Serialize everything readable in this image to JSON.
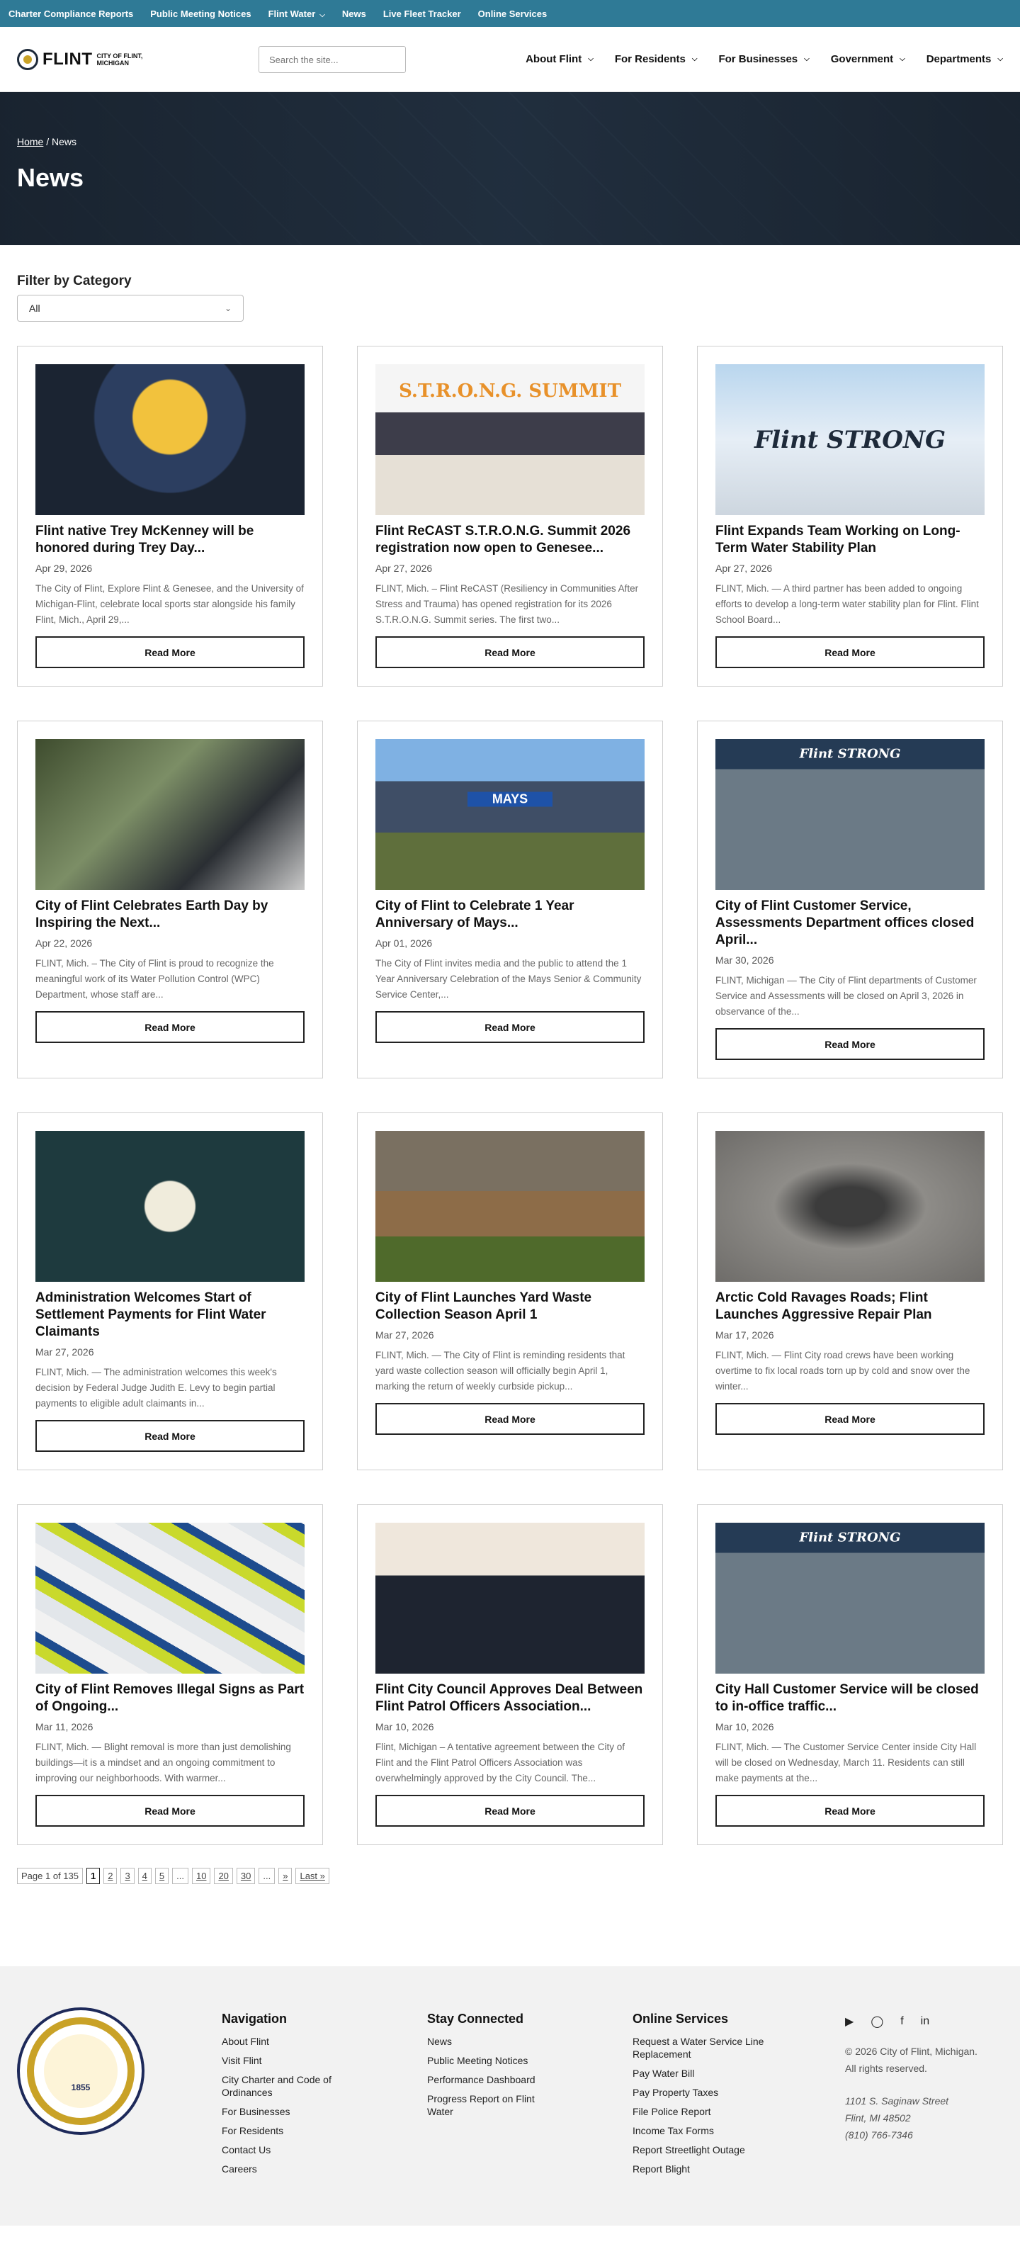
{
  "utility": [
    "Charter Compliance Reports",
    "Public Meeting Notices",
    "Flint Water",
    "News",
    "Live Fleet Tracker",
    "Online Services"
  ],
  "logo": {
    "word": "FLINT",
    "sub1": "CITY OF FLINT,",
    "sub2": "MICHIGAN"
  },
  "search": {
    "placeholder": "Search the site..."
  },
  "nav": [
    "About Flint",
    "For Residents",
    "For Businesses",
    "Government",
    "Departments"
  ],
  "hero": {
    "crumb_home": "Home",
    "crumb_sep": " / ",
    "crumb_current": "News",
    "title": "News"
  },
  "filter": {
    "heading": "Filter by Category",
    "selected": "All"
  },
  "read_more": "Read More",
  "cards": [
    {
      "title": "Flint native Trey McKenney will be honored during Trey Day...",
      "date": "Apr 29, 2026",
      "excerpt": "The City of Flint, Explore Flint & Genesee, and the University of Michigan-Flint, celebrate local sports star alongside his family Flint, Mich., April 29,..."
    },
    {
      "title": "Flint ReCAST S.T.R.O.N.G. Summit 2026 registration now open to Genesee...",
      "date": "Apr 27, 2026",
      "excerpt": "FLINT, Mich. – Flint ReCAST (Resiliency in Communities After Stress and Trauma) has opened registration for its 2026 S.T.R.O.N.G. Summit series. The first two...",
      "image_text": "S.T.R.O.N.G. SUMMIT"
    },
    {
      "title": "Flint Expands Team Working on Long-Term Water Stability Plan",
      "date": "Apr 27, 2026",
      "excerpt": "FLINT, Mich. — A third partner has been added to ongoing efforts to develop a long-term water stability plan for Flint. Flint School Board...",
      "image_text": "Flint STRONG"
    },
    {
      "title": "City of Flint Celebrates Earth Day by Inspiring the Next...",
      "date": "Apr 22, 2026",
      "excerpt": "FLINT, Mich. – The City of Flint is proud to recognize the meaningful work of its Water Pollution Control (WPC) Department, whose staff are..."
    },
    {
      "title": "City of Flint to Celebrate 1 Year Anniversary of Mays...",
      "date": "Apr 01, 2026",
      "excerpt": "The City of Flint invites media and the public to attend the 1 Year Anniversary Celebration of the Mays Senior & Community Service Center,...",
      "image_text": "MAYS"
    },
    {
      "title": "City of Flint Customer Service, Assessments Department offices closed April...",
      "date": "Mar 30, 2026",
      "excerpt": "FLINT, Michigan — The City of Flint departments of Customer Service and Assessments will be closed on April 3, 2026 in observance of the...",
      "image_text": "Flint STRONG"
    },
    {
      "title": "Administration Welcomes Start of Settlement Payments for Flint Water Claimants",
      "date": "Mar 27, 2026",
      "excerpt": "FLINT, Mich. — The administration welcomes this week's decision by Federal Judge Judith E. Levy to begin partial payments to eligible adult claimants in..."
    },
    {
      "title": "City of Flint Launches Yard Waste Collection Season April 1",
      "date": "Mar 27, 2026",
      "excerpt": "FLINT, Mich. — The City of Flint is reminding residents that yard waste collection season will officially begin April 1, marking the return of weekly curbside pickup..."
    },
    {
      "title": "Arctic Cold Ravages Roads; Flint Launches Aggressive Repair Plan",
      "date": "Mar 17, 2026",
      "excerpt": "FLINT, Mich. — Flint City road crews have been working overtime to fix local roads torn up by cold and snow over the winter..."
    },
    {
      "title": "City of Flint Removes Illegal Signs as Part of Ongoing...",
      "date": "Mar 11, 2026",
      "excerpt": "FLINT, Mich. — Blight removal is more than just demolishing buildings—it is a mindset and an ongoing commitment to improving our neighborhoods. With warmer..."
    },
    {
      "title": "Flint City Council Approves Deal Between Flint Patrol Officers Association...",
      "date": "Mar 10, 2026",
      "excerpt": "Flint, Michigan – A tentative agreement between the City of Flint and the Flint Patrol Officers Association was overwhelmingly approved by the City Council. The..."
    },
    {
      "title": "City Hall Customer Service will be closed to in-office traffic...",
      "date": "Mar 10, 2026",
      "excerpt": "FLINT, Mich. — The Customer Service Center inside City Hall will be closed on Wednesday, March 11. Residents can still make payments at the...",
      "image_text": "Flint STRONG"
    }
  ],
  "pager": {
    "label": "Page 1 of 135",
    "pages": [
      "1",
      "2",
      "3",
      "4",
      "5",
      "...",
      "10",
      "20",
      "30",
      "...",
      "»",
      "Last »"
    ]
  },
  "footer": {
    "seal_year": "1855",
    "nav_heading": "Navigation",
    "nav_links": [
      "About Flint",
      "Visit Flint",
      "City Charter and Code of Ordinances",
      "For Businesses",
      "For Residents",
      "Contact Us",
      "Careers"
    ],
    "connect_heading": "Stay Connected",
    "connect_links": [
      "News",
      "Public Meeting Notices",
      "Performance Dashboard",
      "Progress Report on Flint Water"
    ],
    "services_heading": "Online Services",
    "services_links": [
      "Request a Water Service Line Replacement",
      "Pay Water Bill",
      "Pay Property Taxes",
      "File Police Report",
      "Income Tax Forms",
      "Report Streetlight Outage",
      "Report Blight"
    ],
    "copy1": "© 2026 City of Flint, Michigan.",
    "copy2": "All rights reserved.",
    "addr1": "1101 S. Saginaw Street",
    "addr2": "Flint, MI 48502",
    "phone": "(810) 766-7346"
  }
}
